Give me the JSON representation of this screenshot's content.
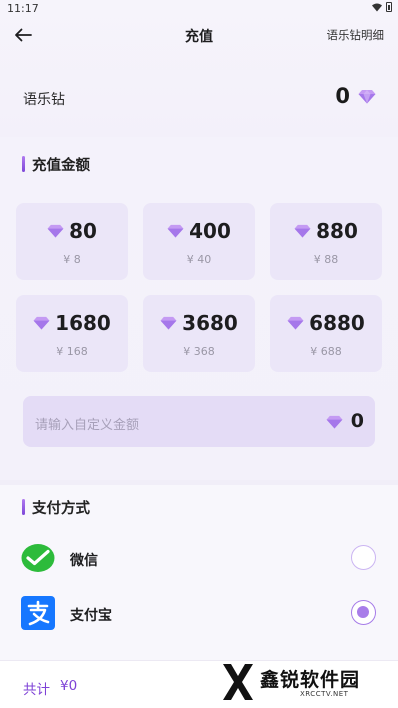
{
  "status_bar": {
    "time": "11:17"
  },
  "header": {
    "title": "充值",
    "detail_link": "语乐钻明细"
  },
  "balance": {
    "label": "语乐钻",
    "value": "0"
  },
  "recharge": {
    "section_title": "充值金额",
    "options": [
      {
        "amount": "80",
        "price": "¥ 8"
      },
      {
        "amount": "400",
        "price": "¥ 40"
      },
      {
        "amount": "880",
        "price": "¥ 88"
      },
      {
        "amount": "1680",
        "price": "¥ 168"
      },
      {
        "amount": "3680",
        "price": "¥ 368"
      },
      {
        "amount": "6880",
        "price": "¥ 688"
      }
    ],
    "custom": {
      "placeholder": "请输入自定义金额",
      "value": "0"
    }
  },
  "payment": {
    "section_title": "支付方式",
    "methods": [
      {
        "label": "微信",
        "selected": false
      },
      {
        "label": "支付宝",
        "selected": true
      }
    ]
  },
  "footer": {
    "total_label": "共计",
    "total_value": "¥0"
  },
  "watermark": {
    "name": "鑫锐软件园",
    "site": "XRCCTV.NET"
  },
  "colors": {
    "accent": "#8b55e0",
    "card_bg": "#ebe6f8",
    "gem": "#b78cf0",
    "wechat": "#2dbb3b",
    "alipay": "#1677ff"
  }
}
